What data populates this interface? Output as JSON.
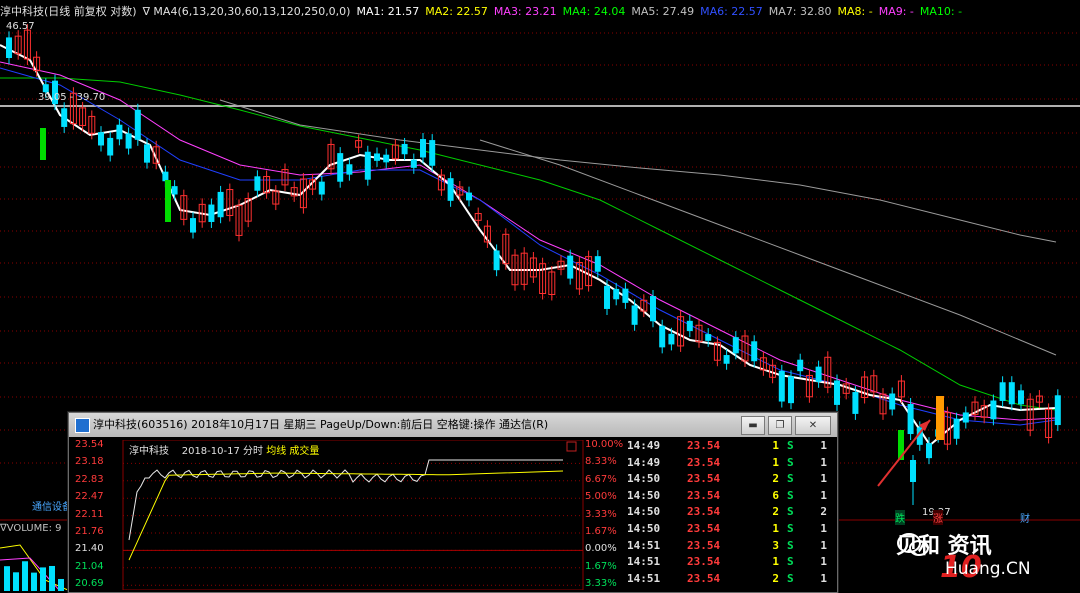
{
  "legend": {
    "stock_header": "淳中科技(日线 前复权 对数)",
    "indicator": "∇ MA4(6,13,20,30,60,13,120,250,0,0)",
    "ma": [
      {
        "label": "MA1: 21.57",
        "color": "#ffffff"
      },
      {
        "label": "MA2: 22.57",
        "color": "#ffff00"
      },
      {
        "label": "MA3: 23.21",
        "color": "#ff40ff"
      },
      {
        "label": "MA4: 24.04",
        "color": "#00ff00"
      },
      {
        "label": "MA5: 27.49",
        "color": "#c0c0c0"
      },
      {
        "label": "MA6: 22.57",
        "color": "#3050ff"
      },
      {
        "label": "MA7: 32.80",
        "color": "#c0c0c0"
      },
      {
        "label": "MA8: -",
        "color": "#ffff00"
      },
      {
        "label": "MA9: -",
        "color": "#ff40ff"
      },
      {
        "label": "MA10: -",
        "color": "#00ff00"
      }
    ]
  },
  "chart": {
    "high_label": "46.57",
    "level_label": "39.05 - 39.70",
    "low_label": "19.27",
    "markers": [
      "跌",
      "涨",
      "财"
    ],
    "colors": {
      "up": "#ff3030",
      "down": "#00e0ff",
      "limit_up": "#ff9900",
      "limit_down": "#00dd00"
    }
  },
  "sector_label": "通信设备",
  "volume_label": "∇VOLUME: 9",
  "dialog": {
    "title": "淳中科技(603516) 2018年10月17日 星期三 PageUp/Down:前后日 空格键:操作 通达信(R)",
    "buttons": [
      "▬",
      "❐",
      "✕"
    ],
    "mini_header": {
      "name": "淳中科技",
      "date": "2018-10-17 分时",
      "avg_line": "均线",
      "volume": "成交量"
    },
    "y_axis": [
      "23.54",
      "23.18",
      "22.83",
      "22.47",
      "22.11",
      "21.76",
      "21.40",
      "21.04",
      "20.69"
    ],
    "pct_axis": [
      "10.00%",
      "8.33%",
      "6.67%",
      "5.00%",
      "3.33%",
      "1.67%",
      "0.00%",
      "1.67%",
      "3.33%"
    ],
    "ticks": [
      {
        "time": "14:49",
        "price": "23.54",
        "vol": "1",
        "side": "S",
        "n": "1"
      },
      {
        "time": "14:49",
        "price": "23.54",
        "vol": "1",
        "side": "S",
        "n": "1"
      },
      {
        "time": "14:50",
        "price": "23.54",
        "vol": "2",
        "side": "S",
        "n": "1"
      },
      {
        "time": "14:50",
        "price": "23.54",
        "vol": "6",
        "side": "S",
        "n": "1"
      },
      {
        "time": "14:50",
        "price": "23.54",
        "vol": "2",
        "side": "S",
        "n": "2"
      },
      {
        "time": "14:50",
        "price": "23.54",
        "vol": "1",
        "side": "S",
        "n": "1"
      },
      {
        "time": "14:51",
        "price": "23.54",
        "vol": "3",
        "side": "S",
        "n": "1"
      },
      {
        "time": "14:51",
        "price": "23.54",
        "vol": "1",
        "side": "S",
        "n": "1"
      },
      {
        "time": "14:51",
        "price": "23.54",
        "vol": "2",
        "side": "S",
        "n": "1"
      }
    ]
  },
  "watermark": {
    "brand": "贝和 资讯",
    "ten": "10",
    "site": "Huang.CN"
  }
}
